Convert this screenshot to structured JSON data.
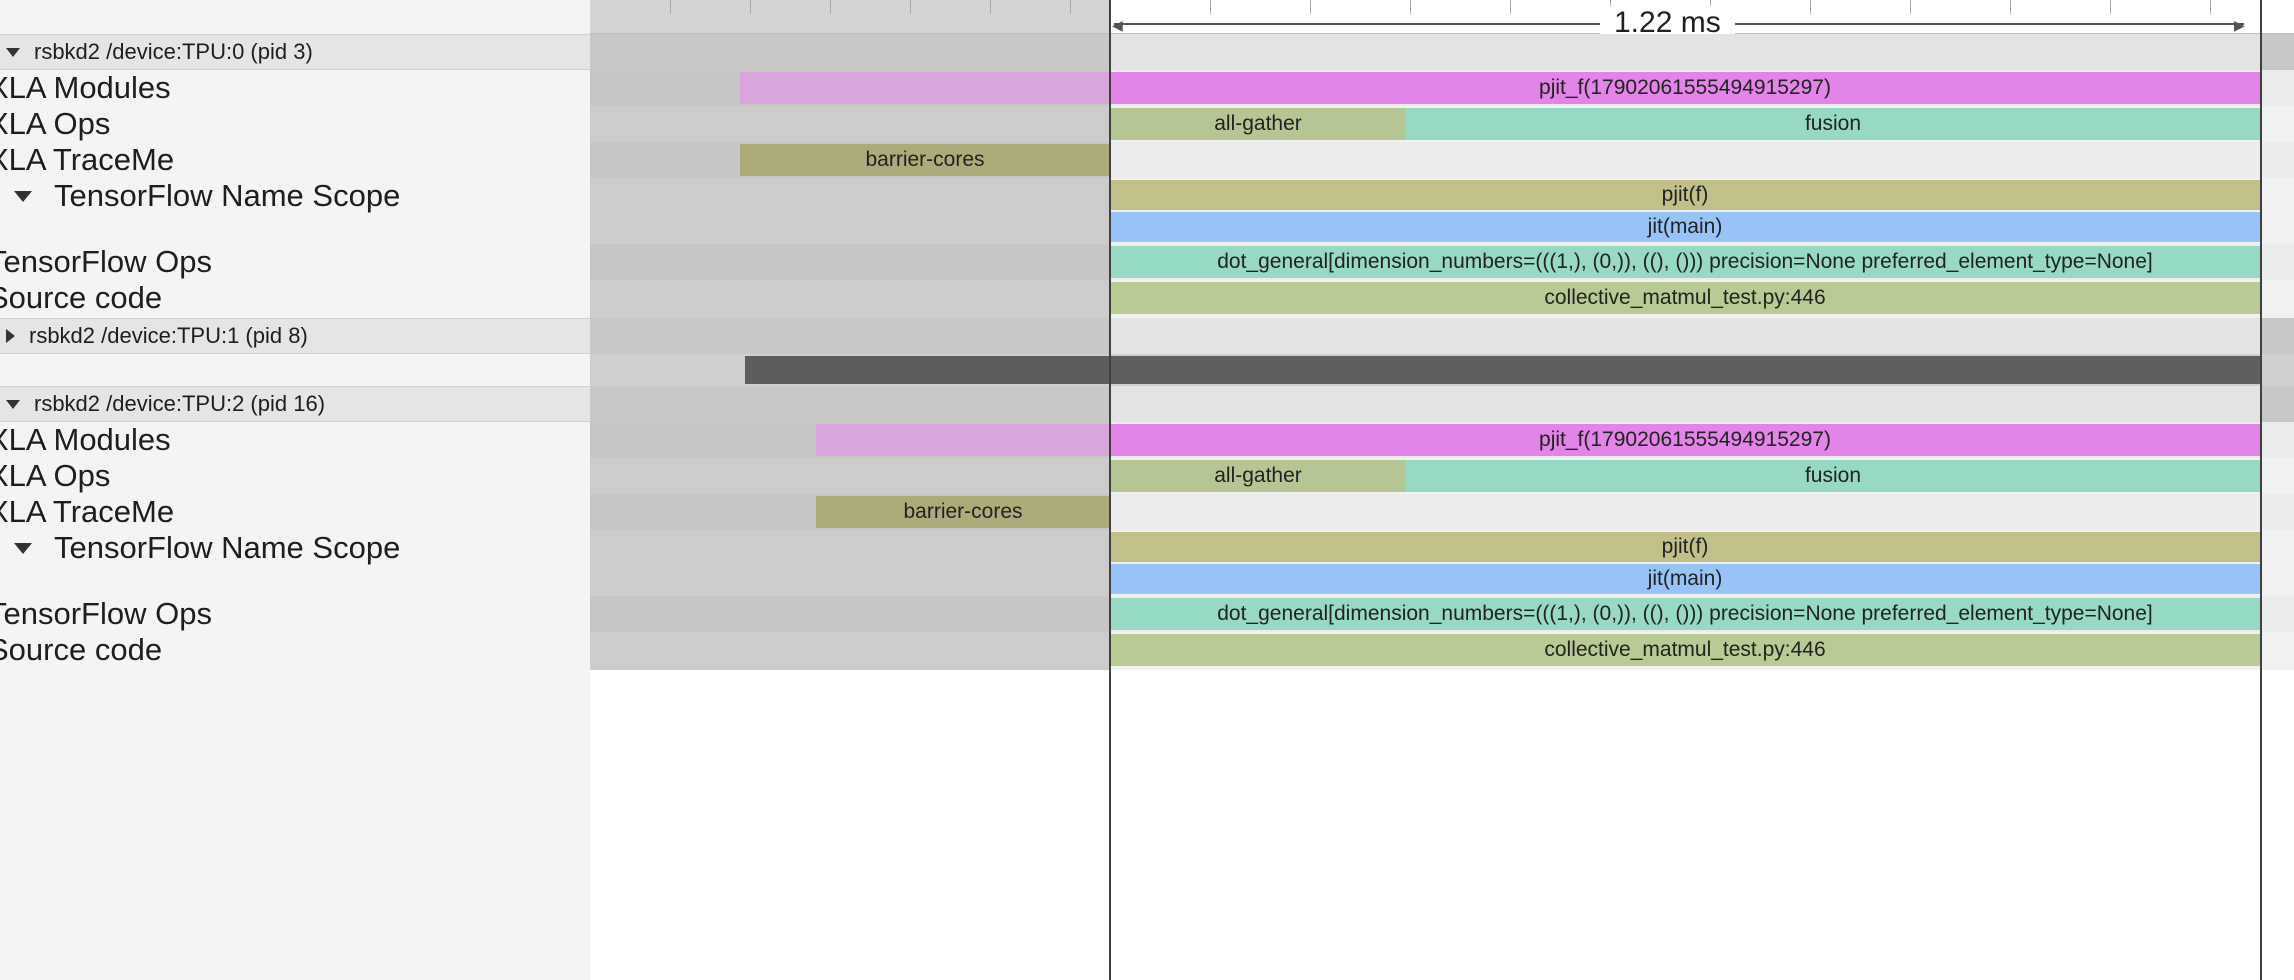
{
  "processes": [
    {
      "name": "rsbkd2 /device:TPU:0 (pid 3)",
      "expanded": true
    },
    {
      "name": "rsbkd2 /device:TPU:1 (pid 8)",
      "expanded": false
    },
    {
      "name": "rsbkd2 /device:TPU:2 (pid 16)",
      "expanded": true
    }
  ],
  "rows": {
    "xla_modules": "XLA Modules",
    "xla_ops": "XLA Ops",
    "xla_traceme": "XLA TraceMe",
    "tf_name_scope": "TensorFlow Name Scope",
    "tf_ops": "TensorFlow Ops",
    "source_code": "Source code"
  },
  "ruler": {
    "duration": "1.22 ms"
  },
  "slices": {
    "module": "pjit_f(17902061555494915297)",
    "all_gather": "all-gather",
    "fusion": "fusion",
    "barrier": "barrier-cores",
    "pjit": "pjit(f)",
    "jit_main": "jit(main)",
    "dot_general": "dot_general[dimension_numbers=(((1,), (0,)), ((), ())) precision=None preferred_element_type=None]",
    "source": "collective_matmul_test.py:446"
  },
  "colors": {
    "module": "#e384e9",
    "module_faded": "#d9a3db",
    "all_gather": "#b5c594",
    "fusion": "#98d9c5",
    "barrier": "#aeab7a",
    "pjit": "#c2c08a",
    "jit_main": "#97c3f7",
    "dot_general": "#98d9c5",
    "source": "#b9cb95",
    "dim_region": "#c9c9c9",
    "selection_bar": "#5d5d5d"
  }
}
